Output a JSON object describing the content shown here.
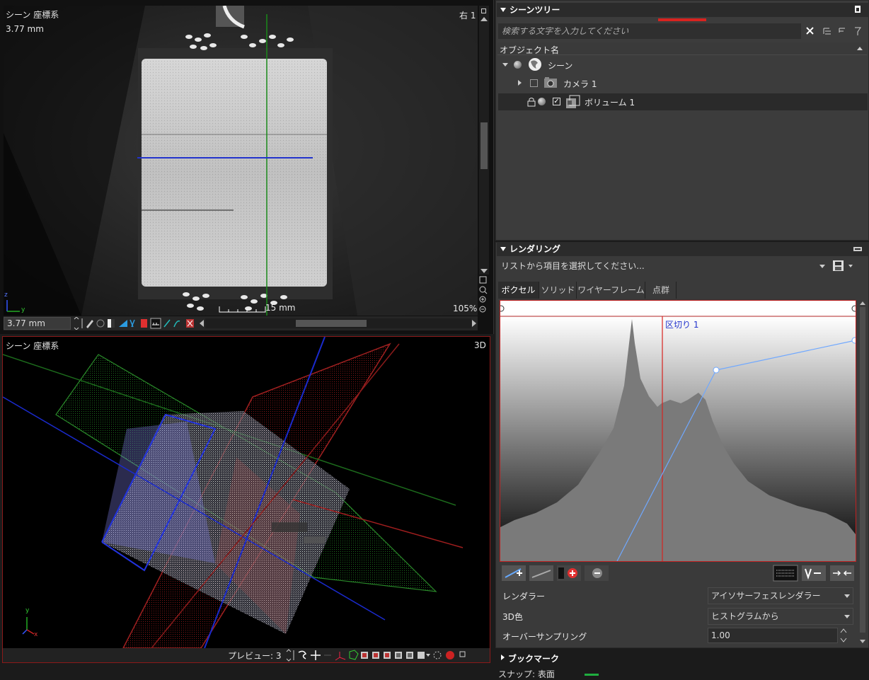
{
  "top_view": {
    "coord_label": "シーン 座標系",
    "slice_thickness": "3.77 mm",
    "view_name": "右 1",
    "scale_label": "15 mm",
    "zoom": "105%",
    "thickness_field": "3.77 mm"
  },
  "bottom_view": {
    "coord_label": "シーン 座標系",
    "view_name": "3D",
    "preview_label": "プレビュー: 3"
  },
  "scene_tree": {
    "title": "シーンツリー",
    "search_placeholder": "検索する文字を入力してください",
    "column_header": "オブジェクト名",
    "items": [
      {
        "label": "シーン",
        "checked": false
      },
      {
        "label": "カメラ 1",
        "checked": false
      },
      {
        "label": "ボリューム 1",
        "checked": true
      }
    ]
  },
  "rendering": {
    "title": "レンダリング",
    "preset_placeholder": "リストから項目を選択してください...",
    "tabs": [
      "ボクセル",
      "ソリッド",
      "ワイヤーフレーム",
      "点群"
    ],
    "active_tab": "ボクセル",
    "marker_label": "区切り 1",
    "properties": [
      {
        "label": "レンダラー",
        "value": "アイソサーフェスレンダラー"
      },
      {
        "label": "3D色",
        "value": "ヒストグラムから"
      },
      {
        "label": "オーバーサンプリング",
        "value": "1.00"
      }
    ],
    "colors": {
      "accent_red": "#d8231f",
      "curve_blue": "#6fa8ff"
    }
  },
  "bookmark": {
    "title": "ブックマーク",
    "snap_label": "スナップ: 表面"
  },
  "axes": {
    "x": "x",
    "y": "y",
    "z": "z"
  }
}
